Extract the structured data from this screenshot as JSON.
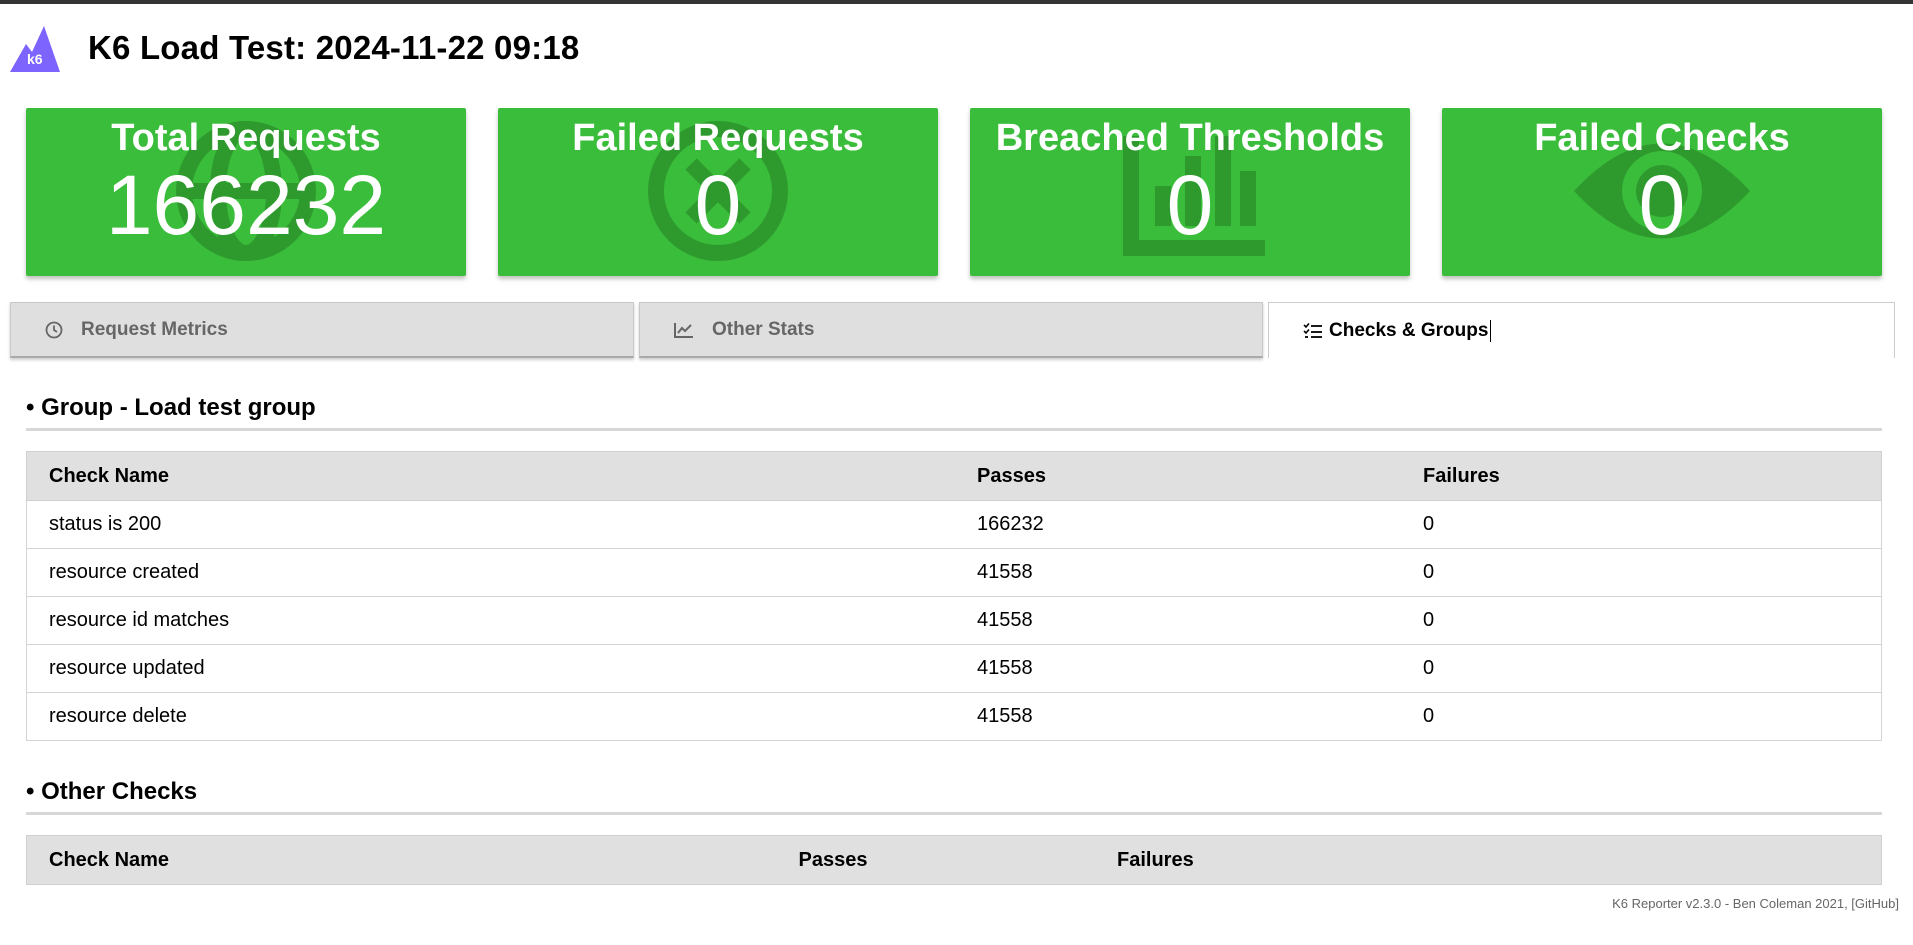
{
  "header": {
    "logo_text": "k6",
    "title": "K6 Load Test: 2024-11-22 09:18"
  },
  "cards": [
    {
      "title": "Total Requests",
      "value": "166232",
      "icon": "globe-icon"
    },
    {
      "title": "Failed Requests",
      "value": "0",
      "icon": "x-circle-icon"
    },
    {
      "title": "Breached Thresholds",
      "value": "0",
      "icon": "bar-chart-icon"
    },
    {
      "title": "Failed Checks",
      "value": "0",
      "icon": "eye-icon"
    }
  ],
  "tabs": [
    {
      "label": "Request Metrics",
      "icon": "clock-icon"
    },
    {
      "label": "Other Stats",
      "icon": "line-chart-icon"
    },
    {
      "label": "Checks & Groups",
      "icon": "checklist-icon",
      "active": true
    }
  ],
  "group_section": {
    "heading": "• Group - Load test group",
    "columns": [
      "Check Name",
      "Passes",
      "Failures"
    ],
    "rows": [
      {
        "name": "status is 200",
        "passes": "166232",
        "failures": "0"
      },
      {
        "name": "resource created",
        "passes": "41558",
        "failures": "0"
      },
      {
        "name": "resource id matches",
        "passes": "41558",
        "failures": "0"
      },
      {
        "name": "resource updated",
        "passes": "41558",
        "failures": "0"
      },
      {
        "name": "resource delete",
        "passes": "41558",
        "failures": "0"
      }
    ]
  },
  "other_section": {
    "heading": "• Other Checks",
    "columns": [
      "Check Name",
      "Passes",
      "Failures"
    ]
  },
  "footer": "K6 Reporter v2.3.0 - Ben Coleman 2021, [GitHub]",
  "colors": {
    "card_green": "#3abd3a",
    "icon_green": "#2e9a2e",
    "logo_purple": "#7d64ff"
  }
}
